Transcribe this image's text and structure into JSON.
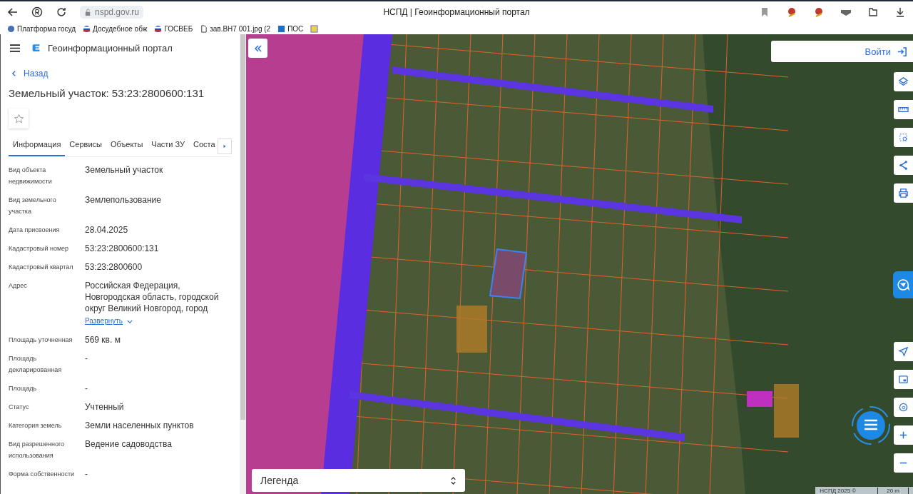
{
  "browser": {
    "url": "nspd.gov.ru",
    "title": "НСПД | Геоинформационный портал",
    "bookmarks": [
      {
        "label": "Платформа госуд"
      },
      {
        "label": "Досудебное обж"
      },
      {
        "label": "ГОСВЕБ"
      },
      {
        "label": "зав.ВН7 001.jpg (2"
      },
      {
        "label": "ПОС"
      }
    ]
  },
  "app": {
    "title": "Геоинформационный портал",
    "back": "Назад",
    "heading": "Земельный участок: 53:23:2800600:131",
    "favorite": false,
    "tabs": [
      {
        "label": "Информация",
        "selected": true
      },
      {
        "label": "Сервисы",
        "selected": false
      },
      {
        "label": "Объекты",
        "selected": false
      },
      {
        "label": "Части ЗУ",
        "selected": false
      },
      {
        "label": "Соста",
        "selected": false
      }
    ],
    "fields": [
      {
        "label": "Вид объекта недвижимости",
        "value": "Земельный участок"
      },
      {
        "label": "Вид земельного участка",
        "value": "Землепользование"
      },
      {
        "label": "Дата присвоения",
        "value": "28.04.2025"
      },
      {
        "label": "Кадастровый номер",
        "value": "53:23:2800600:131"
      },
      {
        "label": "Кадастровый квартал",
        "value": "53:23:2800600"
      },
      {
        "label": "Адрес",
        "value": "Российская Федерация, Новгородская область, городской округ Великий Новгород, город",
        "expand": "Развернуть"
      },
      {
        "label": "Площадь уточненная",
        "value": "569 кв. м"
      },
      {
        "label": "Площадь декларированная",
        "value": "-"
      },
      {
        "label": "Площадь",
        "value": "-"
      },
      {
        "label": "Статус",
        "value": "Учтенный"
      },
      {
        "label": "Категория земель",
        "value": "Земли населенных пунктов"
      },
      {
        "label": "Вид разрешенного использования",
        "value": "Ведение садоводства"
      },
      {
        "label": "Форма собственности",
        "value": "-"
      }
    ]
  },
  "map": {
    "login": "Войти",
    "legend": "Легенда",
    "attribution": "НСПД 2025 ©",
    "scale": "20 m"
  }
}
